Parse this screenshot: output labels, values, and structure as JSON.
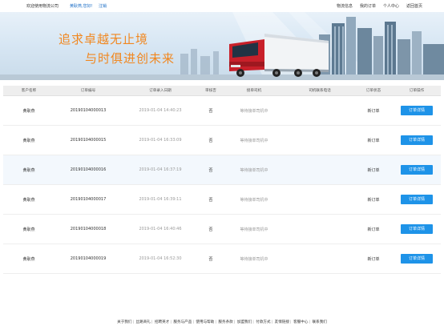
{
  "topbar": {
    "welcome": "欢迎使用物流公司",
    "user": "黄耿燕,您好!",
    "logout": "注销",
    "nav": [
      "物流信息",
      "我的订单",
      "个人中心",
      "返回首页"
    ]
  },
  "banner": {
    "slogan1": "追求卓越无止境",
    "slogan2": "与时俱进创未来"
  },
  "table": {
    "headers": [
      "客户名称",
      "订单编号",
      "订单录入日期",
      "审核否",
      "接单司机",
      "司机联系电话",
      "订单状态",
      "订单操作"
    ],
    "rows": [
      {
        "customer": "黄耿燕",
        "order_no": "20190104000013",
        "date": "2019-01-04 14:40:23",
        "audited": "否",
        "driver": "等待接单司机中",
        "phone": "",
        "status": "新订单",
        "action": "订单详情"
      },
      {
        "customer": "黄耿燕",
        "order_no": "20190104000015",
        "date": "2019-01-04 16:33:09",
        "audited": "否",
        "driver": "等待接单司机中",
        "phone": "",
        "status": "新订单",
        "action": "订单详情"
      },
      {
        "customer": "黄耿燕",
        "order_no": "20190104000016",
        "date": "2019-01-04 16:37:19",
        "audited": "否",
        "driver": "等待接单司机中",
        "phone": "",
        "status": "新订单",
        "action": "订单详情"
      },
      {
        "customer": "黄耿燕",
        "order_no": "20190104000017",
        "date": "2019-01-04 16:39:11",
        "audited": "否",
        "driver": "等待接单司机中",
        "phone": "",
        "status": "新订单",
        "action": "订单详情"
      },
      {
        "customer": "黄耿燕",
        "order_no": "20190104000018",
        "date": "2019-01-04 16:40:46",
        "audited": "否",
        "driver": "等待接单司机中",
        "phone": "",
        "status": "新订单",
        "action": "订单详情"
      },
      {
        "customer": "黄耿燕",
        "order_no": "20190104000019",
        "date": "2019-01-04 16:52:30",
        "audited": "否",
        "driver": "等待接单司机中",
        "phone": "",
        "status": "新订单",
        "action": "订单详情"
      }
    ]
  },
  "footer": {
    "links": [
      "关于我们",
      "丝路商礼",
      "招聘英才",
      "服务与产品",
      "使用与帮助",
      "服务条款",
      "加盟我们",
      "付款方式",
      "友情链接",
      "客服中心",
      "联系我们"
    ]
  },
  "colors": {
    "accent": "#1e93e8",
    "slogan": "#f1871f",
    "link": "#1d6fc7",
    "truck_cab": "#c8202a"
  }
}
